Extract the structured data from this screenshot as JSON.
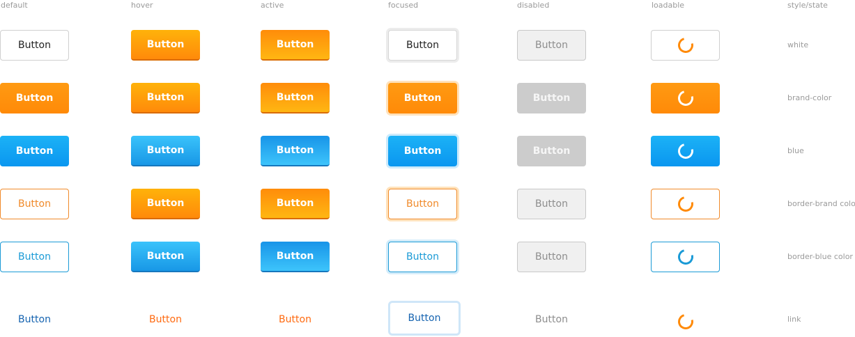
{
  "columns": [
    "default",
    "hover",
    "active",
    "focused",
    "disabled",
    "loadable",
    "style/state"
  ],
  "rows": [
    "white",
    "brand-color",
    "blue",
    "border-brand color",
    "border-blue color",
    "link"
  ],
  "button_label": "Button",
  "colors": {
    "brand": "#ff8a08",
    "blue": "#0a96f0",
    "border_brand": "#f08a2a",
    "border_blue": "#1a9ad6",
    "link": "#1563b0",
    "link_hover": "#ff6a10",
    "disabled": "#cccccc"
  },
  "icons": {
    "loading": "spinner-icon"
  }
}
